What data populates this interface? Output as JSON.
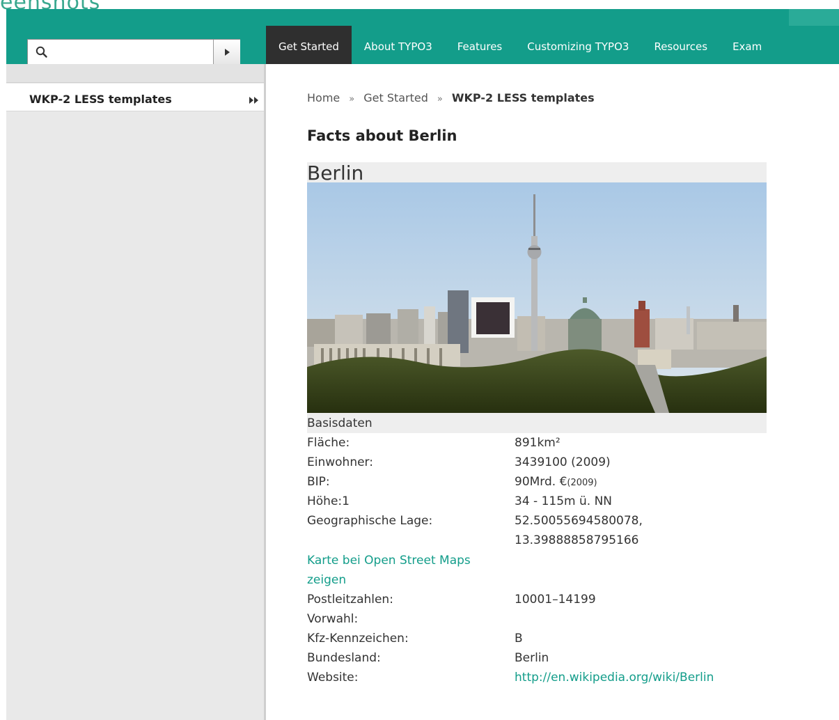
{
  "brand_fragment": "eenshots",
  "colors": {
    "accent": "#139d8a",
    "nav_active": "#2f2f2f",
    "sidebar": "#e9e9e9",
    "link": "#139d8a"
  },
  "search": {
    "value": "",
    "placeholder": "",
    "search_icon": "magnifier-icon",
    "go_icon": "triangle-right-icon"
  },
  "nav": {
    "items": [
      {
        "label": "Get Started",
        "active": true
      },
      {
        "label": "About TYPO3",
        "active": false
      },
      {
        "label": "Features",
        "active": false
      },
      {
        "label": "Customizing TYPO3",
        "active": false
      },
      {
        "label": "Resources",
        "active": false
      },
      {
        "label": "Exam",
        "active": false
      }
    ]
  },
  "sidebar": {
    "active_item": {
      "label": "WKP-2 LESS templates",
      "icon": "double-triangle-right-icon"
    }
  },
  "breadcrumb": {
    "items": [
      "Home",
      "Get Started"
    ],
    "separator": "»",
    "current": "WKP-2 LESS templates"
  },
  "page_title": "Facts about Berlin",
  "infobox": {
    "title": "Berlin",
    "image_subject": "Berlin skyline with TV tower",
    "section": "Basisdaten",
    "facts": {
      "flaeche_label": "Fläche:",
      "flaeche_value": "891km²",
      "einwohner_label": "Einwohner:",
      "einwohner_value": "3439100 (2009)",
      "bip_label": "BIP:",
      "bip_value": "90Mrd. €",
      "bip_year": "(2009)",
      "hoehe_label": "Höhe:1",
      "hoehe_value": "34 - 115m ü. NN",
      "lage_label": "Geographische Lage:",
      "lage_value_1": "52.50055694580078,",
      "lage_value_2": "13.39888858795166",
      "map_link_1": "Karte bei Open Street Maps",
      "map_link_2": "zeigen",
      "plz_label": "Postleitzahlen:",
      "plz_value": "10001–14199",
      "vorwahl_label": "Vorwahl:",
      "kfz_label": "Kfz-Kennzeichen:",
      "kfz_value": "B",
      "bundesland_label": "Bundesland:",
      "bundesland_value": "Berlin",
      "website_label": "Website:",
      "website_value": "http://en.wikipedia.org/wiki/Berlin"
    }
  }
}
